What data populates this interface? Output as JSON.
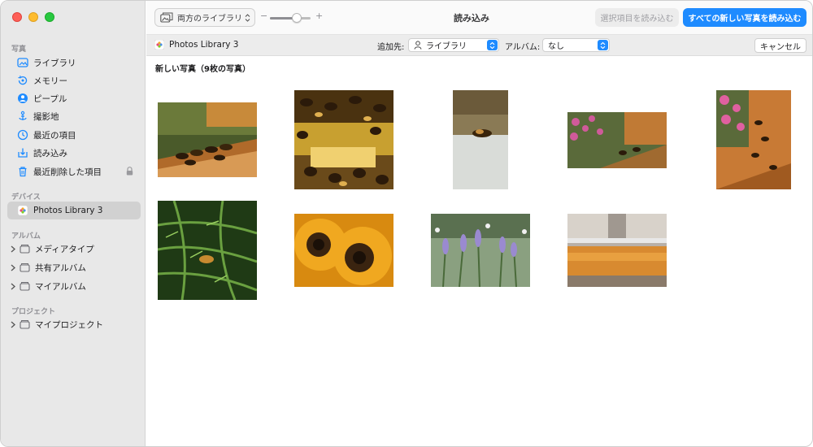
{
  "sidebar": {
    "sections": {
      "photos": "写真",
      "devices": "デバイス",
      "albums": "アルバム",
      "projects": "プロジェクト"
    },
    "items": [
      {
        "label": "ライブラリ",
        "icon": "photo-library-icon"
      },
      {
        "label": "メモリー",
        "icon": "memories-icon"
      },
      {
        "label": "ピープル",
        "icon": "people-icon"
      },
      {
        "label": "撮影地",
        "icon": "places-icon"
      },
      {
        "label": "最近の項目",
        "icon": "recents-icon"
      },
      {
        "label": "読み込み",
        "icon": "imports-icon"
      },
      {
        "label": "最近削除した項目",
        "icon": "trash-icon"
      }
    ],
    "device": {
      "label": "Photos Library 3",
      "icon": "photos-app-icon"
    },
    "albums": [
      {
        "label": "メディアタイプ"
      },
      {
        "label": "共有アルバム"
      },
      {
        "label": "マイアルバム"
      }
    ],
    "projects": [
      {
        "label": "マイプロジェクト"
      }
    ]
  },
  "toolbar": {
    "library_popup": "両方のライブラリ",
    "zoom_minus": "−",
    "zoom_plus": "+",
    "zoom_level": 0.65,
    "title": "読み込み",
    "import_selected": "選択項目を読み込む",
    "import_all": "すべての新しい写真を読み込む"
  },
  "device_bar": {
    "device_name": "Photos Library 3",
    "destination_label": "追加先:",
    "destination_value": "ライブラリ",
    "album_label": "アルバム:",
    "album_value": "なし",
    "cancel": "キャンセル"
  },
  "photos": {
    "heading": "新しい写真（9枚の写真）",
    "items": [
      {
        "subject": "bees on hive landing board"
      },
      {
        "subject": "bees on honeycomb"
      },
      {
        "subject": "single bee on white surface"
      },
      {
        "subject": "hive with pink flowers"
      },
      {
        "subject": "hive entrance with bees and flowers"
      },
      {
        "subject": "bee on fern leaves"
      },
      {
        "subject": "sunflowers"
      },
      {
        "subject": "lavender field"
      },
      {
        "subject": "honey extractor"
      }
    ]
  },
  "colors": {
    "accent": "#1e8bff",
    "sidebar_bg": "#e8e8e8",
    "selected_bg": "#d1d1d1"
  }
}
